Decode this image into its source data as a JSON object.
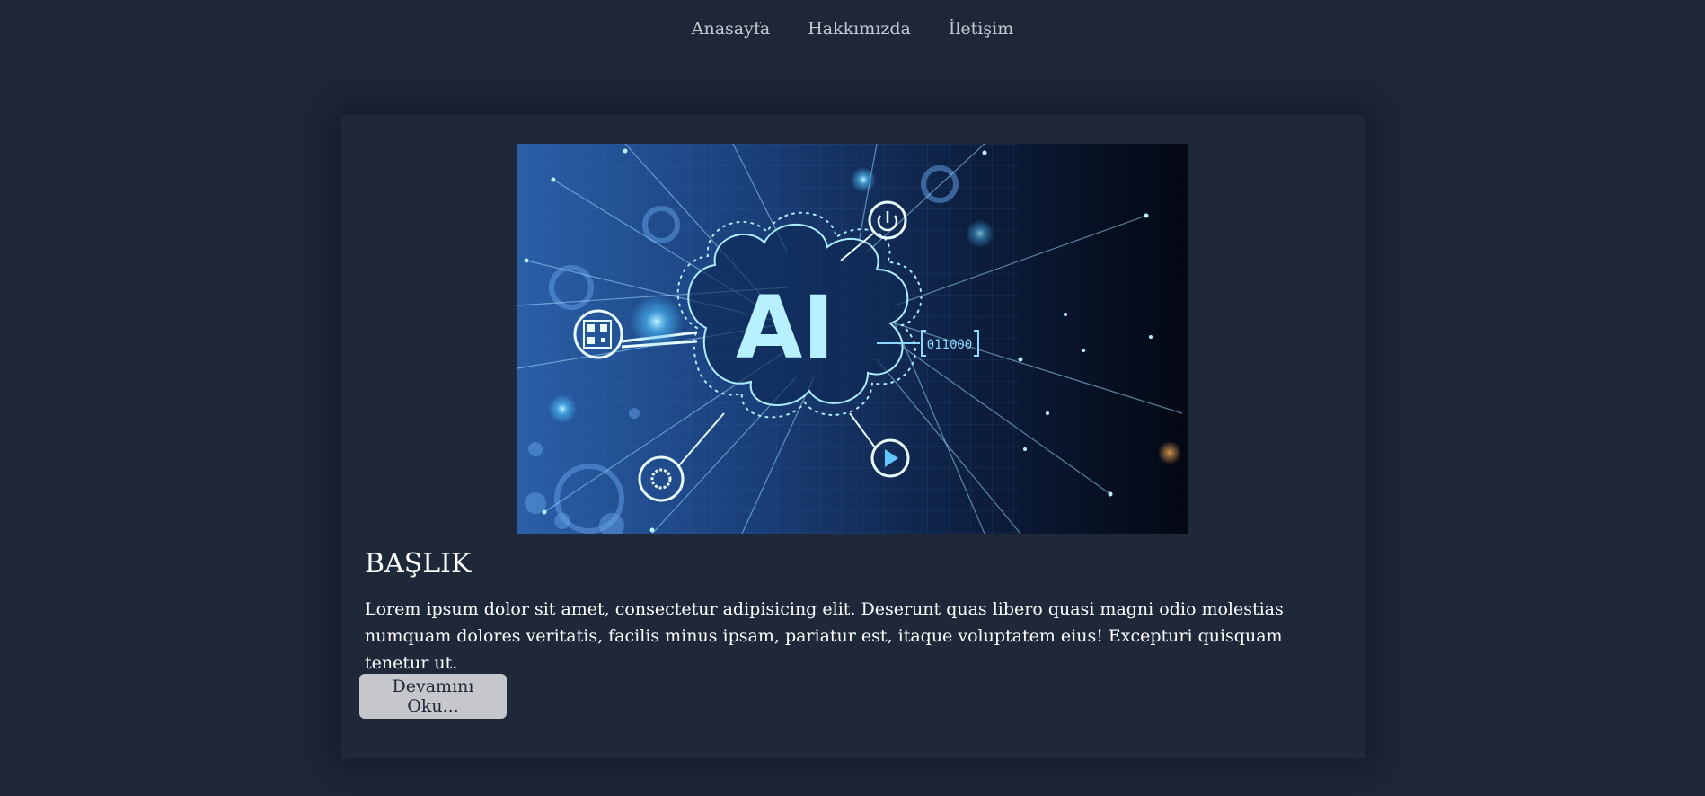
{
  "nav": {
    "items": [
      {
        "label": "Anasayfa"
      },
      {
        "label": "Hakkımızda"
      },
      {
        "label": "İletişim"
      }
    ]
  },
  "post": {
    "image": {
      "text": "AI",
      "icon": "ai-circuit-illustration",
      "code_label": "011000"
    },
    "title": "BAŞLIK",
    "excerpt": "Lorem ipsum dolor sit amet, consectetur adipisicing elit. Deserunt quas libero quasi magni odio molestias numquam dolores veritatis, facilis minus ipsam, pariatur est, itaque voluptatem eius! Excepturi quisquam tenetur ut.",
    "read_more": "Devamını Oku..."
  },
  "colors": {
    "background": "#1e2738",
    "card": "#1f2839",
    "nav_text": "#c4c9d1",
    "button_bg": "#c6c7ca",
    "accent_glow": "#7ee0ff"
  }
}
